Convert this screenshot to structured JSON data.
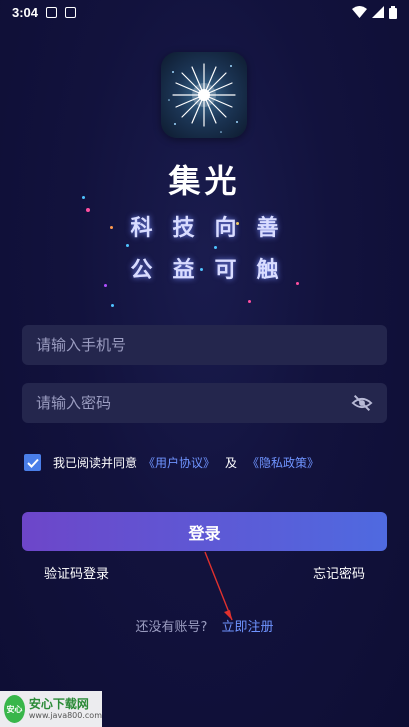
{
  "status_bar": {
    "time": "3:04"
  },
  "app": {
    "name": "集光",
    "slogan_line1": "科技向善",
    "slogan_line2": "公益可触"
  },
  "form": {
    "phone_placeholder": "请输入手机号",
    "password_placeholder": "请输入密码",
    "agreement_prefix": "我已阅读并同意",
    "user_agreement": "《用户协议》",
    "agreement_and": "及",
    "privacy_policy": "《隐私政策》",
    "agreement_checked": true
  },
  "actions": {
    "login_label": "登录",
    "sms_login_label": "验证码登录",
    "forgot_password_label": "忘记密码",
    "no_account_text": "还没有账号?",
    "register_label": "立即注册"
  },
  "watermark": {
    "title": "安心下载网",
    "url": "www.java800.com",
    "badge": "安心"
  },
  "colors": {
    "accent": "#4a7ee8",
    "link": "#6f94ff",
    "button_start": "#6d46c9",
    "button_end": "#4f6ae0",
    "input_bg": "#24264d"
  }
}
